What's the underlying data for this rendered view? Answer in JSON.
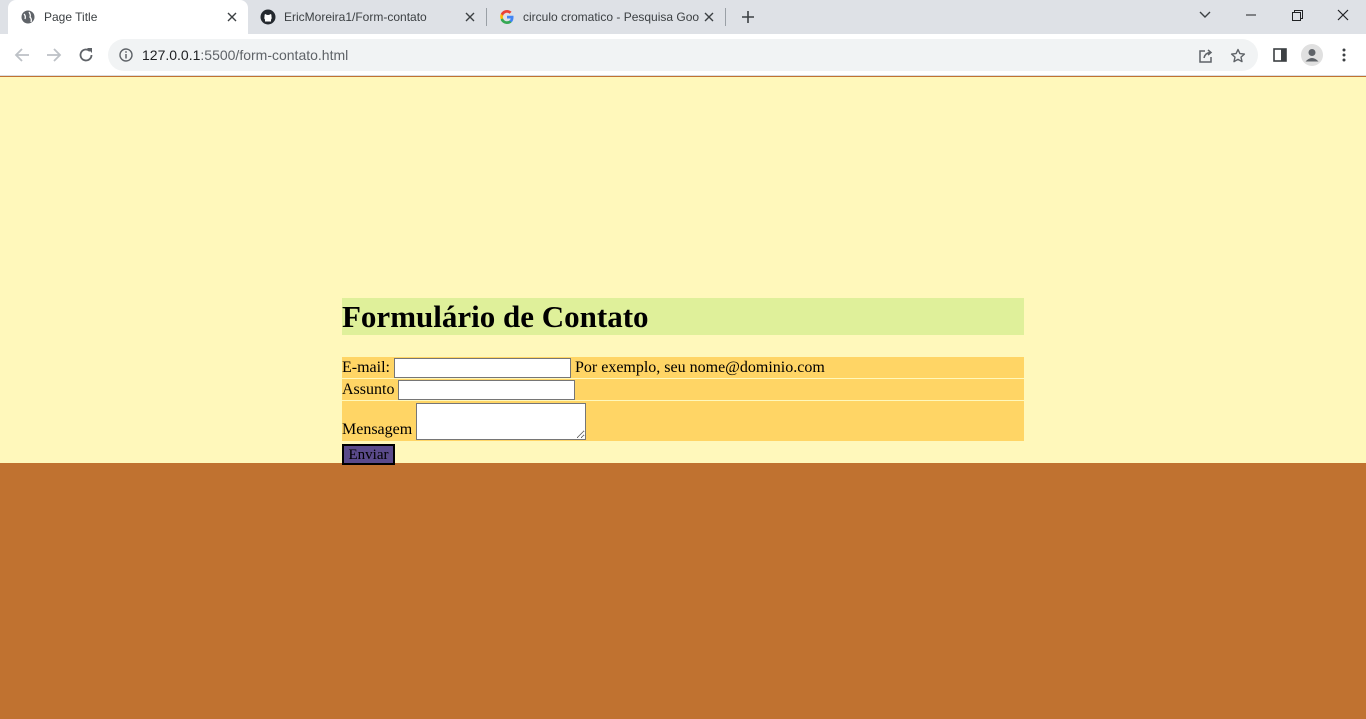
{
  "tabs": [
    {
      "title": "Page Title",
      "icon": "globe-icon"
    },
    {
      "title": "EricMoreira1/Form-contato",
      "icon": "github-icon"
    },
    {
      "title": "circulo cromatico - Pesquisa Goo",
      "icon": "google-icon"
    }
  ],
  "address_bar": {
    "url_host": "127.0.0.1",
    "url_rest": ":5500/form-contato.html"
  },
  "page": {
    "heading": "Formulário de Contato",
    "email_label": "E-mail:",
    "email_value": "",
    "email_hint": "Por exemplo, seu nome@dominio.com",
    "assunto_label": "Assunto",
    "assunto_value": "",
    "mensagem_label": "Mensagem",
    "mensagem_value": "",
    "submit_label": "Enviar"
  },
  "colors": {
    "page_background": "#c07230",
    "main_background": "#fff8bb",
    "heading_background": "#dff09a",
    "form_background": "#ffd565",
    "button_background": "#5a4a8a"
  }
}
